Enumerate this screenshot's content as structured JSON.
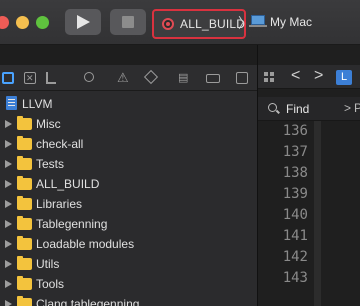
{
  "toolbar": {
    "scheme_name": "ALL_BUILD",
    "chevron": "〉",
    "destination": "My Mac",
    "run_icon": "play-icon",
    "stop_icon": "stop-icon"
  },
  "navigator": {
    "icons": [
      "folder-icon",
      "source-control-icon",
      "symbol-icon",
      "search-icon",
      "warning-icon",
      "test-icon",
      "debug-icon",
      "breakpoint-icon",
      "report-icon"
    ],
    "root": "LLVM",
    "items": [
      {
        "label": "Misc"
      },
      {
        "label": "check-all"
      },
      {
        "label": "Tests"
      },
      {
        "label": "ALL_BUILD"
      },
      {
        "label": "Libraries"
      },
      {
        "label": "Tablegenning"
      },
      {
        "label": "Loadable modules"
      },
      {
        "label": "Utils"
      },
      {
        "label": "Tools"
      },
      {
        "label": "Clang tablegenning"
      }
    ]
  },
  "editor": {
    "back_glyph": "<",
    "forward_glyph": ">",
    "file_icon_letter": "L",
    "find_label": "Find",
    "find_chevron": ">",
    "find_p": "P",
    "line_numbers": [
      "136",
      "137",
      "138",
      "139",
      "140",
      "141",
      "142",
      "143"
    ]
  }
}
